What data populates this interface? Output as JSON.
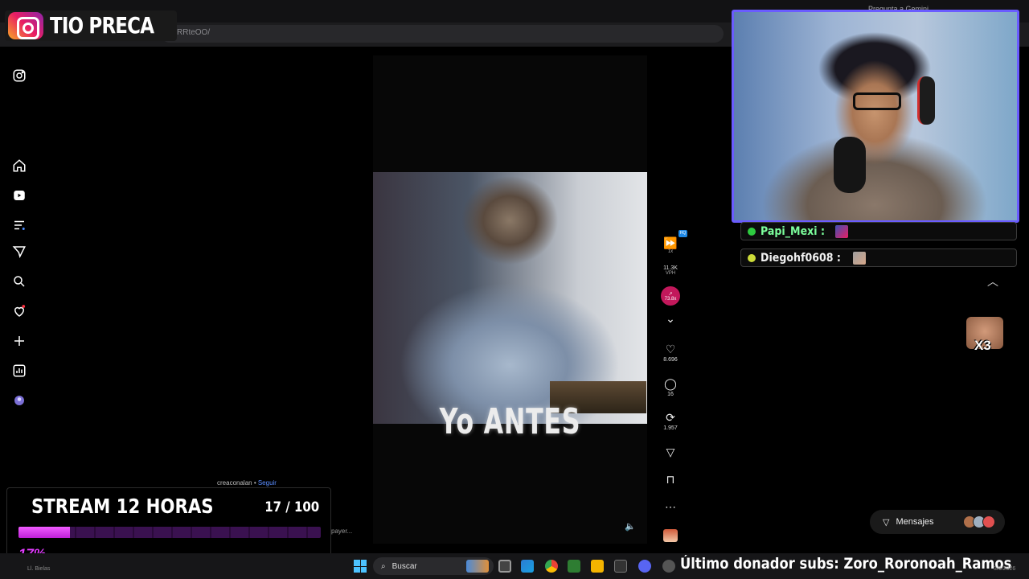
{
  "browser": {
    "tab_title": "Instagram",
    "url_fragment": "RRteOO/",
    "gemini_label": "Pregunta a Gemini"
  },
  "brand": {
    "icon": "instagram-icon",
    "name": "TIO PRECA"
  },
  "left_nav": {
    "items": [
      {
        "icon": "instagram-icon"
      },
      {
        "icon": "home-icon"
      },
      {
        "icon": "reels-icon"
      },
      {
        "icon": "feed-icon"
      },
      {
        "icon": "send-icon"
      },
      {
        "icon": "search-icon"
      },
      {
        "icon": "heart-icon"
      },
      {
        "icon": "plus-icon"
      },
      {
        "icon": "stats-icon"
      },
      {
        "icon": "profile-avatar"
      }
    ]
  },
  "video": {
    "caption": "Yo ANTES",
    "author": "creaconalan",
    "follow_label": "Seguir",
    "player_text": "payer..."
  },
  "actions": {
    "speed": "1x",
    "vph_value": "11.3K",
    "vph_label": "VPH",
    "trend_value": "73.8x",
    "hq_badge": "HQ",
    "likes": "8.696",
    "comments": "16",
    "reposts": "1.957"
  },
  "chat": {
    "messages": [
      {
        "user": "Papi_Mexi :",
        "color": "#7cff9c",
        "dot": "#2ecc40"
      },
      {
        "user": "Diegohf0608 :",
        "color": "#f2f2f2",
        "dot": "#cddc39"
      }
    ],
    "combo": "X3"
  },
  "messages_button": {
    "label": "Mensajes"
  },
  "stream_goal": {
    "title": "STREAM 12 HORAS",
    "count": "17 / 100",
    "percent_label": "17%",
    "progress": 0.17
  },
  "taskbar": {
    "location_text": "Ll. Bielas",
    "search_placeholder": "Buscar",
    "ticker": "Último donador subs: Zoro_Roronoah_Ramos",
    "clock": "3/6/2026"
  },
  "colors": {
    "accent_purple": "#6a5cff",
    "progress_fill": "#e23cff",
    "trend_badge": "#c2185b"
  }
}
